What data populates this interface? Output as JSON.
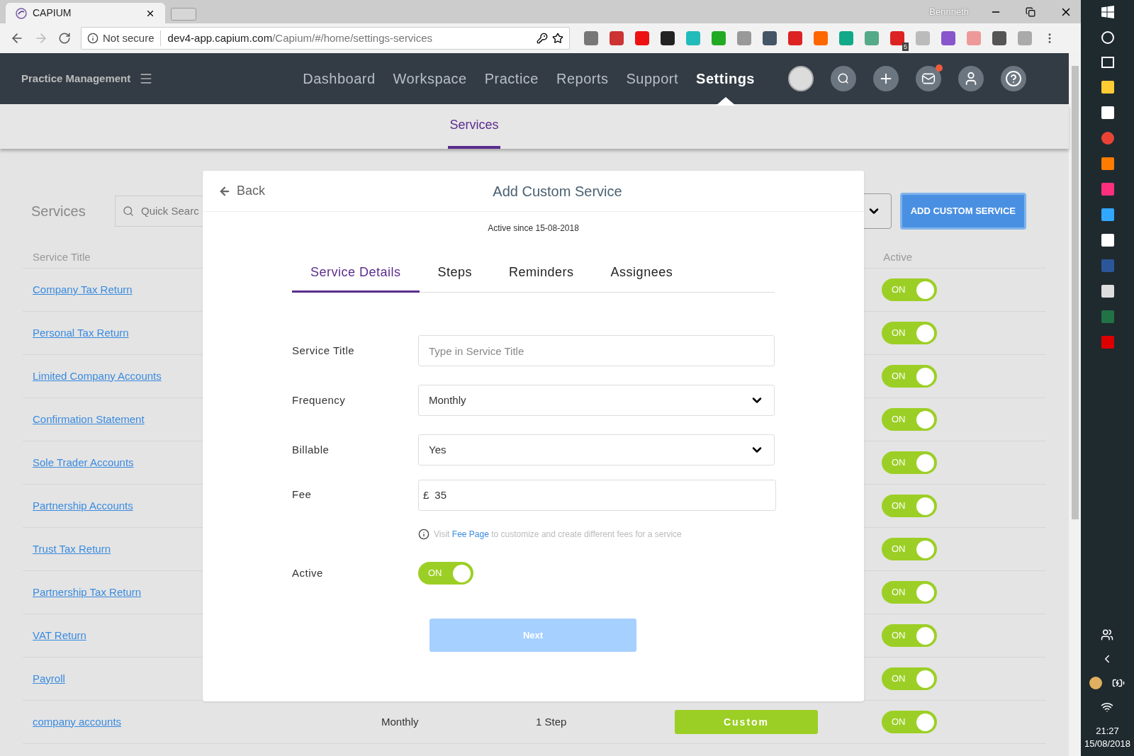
{
  "browser": {
    "tab_title": "CAPIUM",
    "security": "Not secure",
    "url_host": "dev4-app.capium.com",
    "url_path": "/Capium/#/home/settings-services",
    "profile": "Bennneth",
    "extension_badge": "5"
  },
  "app": {
    "brand": "Practice Management",
    "nav": [
      {
        "label": "Dashboard",
        "selected": false
      },
      {
        "label": "Workspace",
        "selected": false
      },
      {
        "label": "Practice",
        "selected": false
      },
      {
        "label": "Reports",
        "selected": false
      },
      {
        "label": "Support",
        "selected": false
      },
      {
        "label": "Settings",
        "selected": true
      }
    ],
    "subnav": [
      {
        "label": "Services",
        "selected": true
      }
    ]
  },
  "page": {
    "title": "Services",
    "search_placeholder": "Quick Searc",
    "add_button": "ADD CUSTOM SERVICE",
    "columns": [
      "Service Title",
      "Active"
    ],
    "rows": [
      {
        "title": "Company Tax Return",
        "active": true,
        "toggle_label": "ON"
      },
      {
        "title": "Personal Tax Return",
        "active": true,
        "toggle_label": "ON"
      },
      {
        "title": "Limited Company Accounts",
        "active": true,
        "toggle_label": "ON"
      },
      {
        "title": "Confirmation Statement",
        "active": true,
        "toggle_label": "ON"
      },
      {
        "title": "Sole Trader Accounts",
        "active": true,
        "toggle_label": "ON"
      },
      {
        "title": "Partnership Accounts",
        "active": true,
        "toggle_label": "ON"
      },
      {
        "title": "Trust Tax Return",
        "active": true,
        "toggle_label": "ON"
      },
      {
        "title": "Partnership Tax Return",
        "active": true,
        "toggle_label": "ON"
      },
      {
        "title": "VAT Return",
        "active": true,
        "toggle_label": "ON"
      },
      {
        "title": "Payroll",
        "active": true,
        "toggle_label": "ON"
      },
      {
        "title": "company accounts",
        "frequency": "Monthly",
        "steps": "1 Step",
        "type": "Custom",
        "active": true,
        "toggle_label": "ON"
      }
    ]
  },
  "modal": {
    "back": "Back",
    "title": "Add Custom Service",
    "active_since": "Active since 15-08-2018",
    "tabs": [
      {
        "label": "Service Details",
        "selected": true
      },
      {
        "label": "Steps",
        "selected": false
      },
      {
        "label": "Reminders",
        "selected": false
      },
      {
        "label": "Assignees",
        "selected": false
      }
    ],
    "fields": [
      {
        "kind": "text",
        "label": "Service Title",
        "placeholder": "Type in Service Title"
      },
      {
        "kind": "select",
        "label": "Frequency",
        "value": "Monthly"
      },
      {
        "kind": "select",
        "label": "Billable",
        "value": "Yes"
      },
      {
        "kind": "money",
        "label": "Fee",
        "currency": "£",
        "value": "35"
      },
      {
        "kind": "hint",
        "text_before": "Visit",
        "link": "Fee Page",
        "text_after": "to customize and create different fees for a service"
      },
      {
        "kind": "toggle",
        "label": "Active",
        "on": true,
        "toggle_label": "ON"
      }
    ],
    "next_button": {
      "label": "Next",
      "disabled": true
    }
  },
  "taskbar": {
    "time": "21:27",
    "date": "15/08/2018"
  }
}
